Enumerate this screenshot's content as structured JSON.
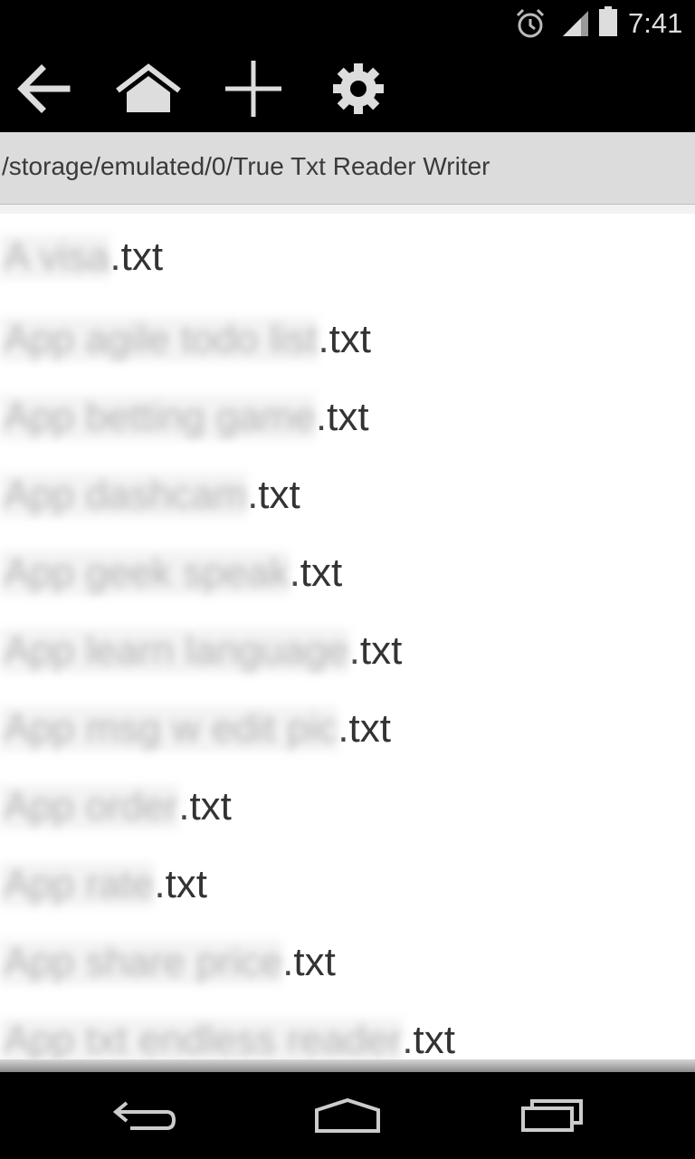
{
  "status_bar": {
    "time": "7:41",
    "icons": [
      "alarm-icon",
      "signal-icon",
      "battery-icon"
    ]
  },
  "toolbar": {
    "buttons": [
      "back-arrow-icon",
      "home-icon",
      "add-icon",
      "settings-gear-icon"
    ]
  },
  "path": "/storage/emulated/0/True Txt Reader Writer",
  "files": [
    {
      "name": "A visa",
      "ext": ".txt"
    },
    {
      "name": "App agile todo list",
      "ext": ".txt"
    },
    {
      "name": "App betting game",
      "ext": ".txt"
    },
    {
      "name": "App dashcam",
      "ext": ".txt"
    },
    {
      "name": "App geek speak",
      "ext": ".txt"
    },
    {
      "name": "App learn language",
      "ext": ".txt"
    },
    {
      "name": "App msg w edit pic",
      "ext": ".txt"
    },
    {
      "name": "App order",
      "ext": ".txt"
    },
    {
      "name": "App rate",
      "ext": ".txt"
    },
    {
      "name": "App share price",
      "ext": ".txt"
    },
    {
      "name": "App txt endless reader",
      "ext": ".txt"
    }
  ],
  "nav_bar": {
    "buttons": [
      "nav-back-icon",
      "nav-home-icon",
      "nav-recents-icon"
    ]
  },
  "colors": {
    "bar_background": "#000000",
    "path_bar": "#dcdcdc",
    "list_background": "#ffffff",
    "file_text": "#333333",
    "icon": "#dddddd"
  }
}
